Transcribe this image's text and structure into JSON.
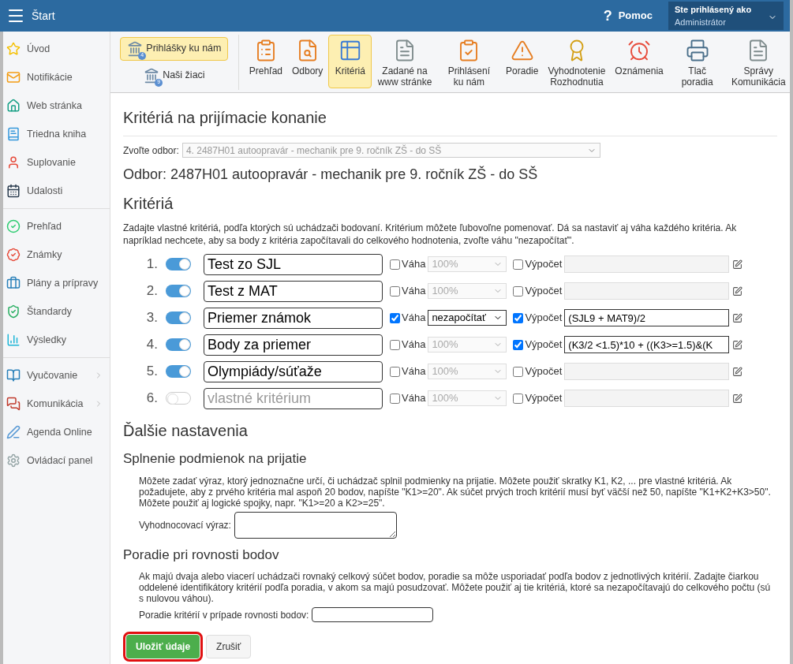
{
  "topbar": {
    "title": "Štart",
    "help": "?",
    "help_label": "Pomoc",
    "user_caption": "Ste prihlásený ako",
    "user_name": "Administrátor"
  },
  "sidebar": {
    "groups": [
      [
        {
          "label": "Úvod"
        },
        {
          "label": "Notifikácie"
        },
        {
          "label": "Web stránka"
        },
        {
          "label": "Triedna kniha"
        },
        {
          "label": "Suplovanie"
        },
        {
          "label": "Udalosti"
        }
      ],
      [
        {
          "label": "Prehľad"
        },
        {
          "label": "Známky"
        },
        {
          "label": "Plány a prípravy"
        },
        {
          "label": "Štandardy"
        },
        {
          "label": "Výsledky"
        }
      ],
      [
        {
          "label": "Vyučovanie",
          "submenu": true
        },
        {
          "label": "Komunikácia",
          "submenu": true
        },
        {
          "label": "Agenda Online",
          "submenu": false
        },
        {
          "label": "Ovládací panel",
          "submenu": false
        }
      ]
    ]
  },
  "toolbar": {
    "left": [
      {
        "label": "Prihlášky ku nám",
        "badge": "4",
        "selected": true
      },
      {
        "label": "Naši žiaci",
        "badge": "9",
        "selected": false
      }
    ],
    "items": [
      {
        "label": "Prehľad",
        "selected": false
      },
      {
        "label": "Odbory",
        "selected": false
      },
      {
        "label": "Kritériá",
        "selected": true
      },
      {
        "label": "Zadané na www stránke",
        "selected": false
      },
      {
        "label": "Prihlásení ku nám",
        "selected": false
      },
      {
        "label": "Poradie",
        "selected": false
      },
      {
        "label": "Vyhodnotenie Rozhodnutia",
        "selected": false
      },
      {
        "label": "Oznámenia",
        "selected": false
      },
      {
        "label": "Tlač poradia",
        "selected": false
      },
      {
        "label": "Správy Komunikácia",
        "selected": false
      }
    ]
  },
  "page": {
    "title": "Kritériá na prijímacie konanie",
    "field_label": "Zvoľte odbor:",
    "field_value": "4. 2487H01 autoopravár - mechanik pre 9. ročník ZŠ - do SŠ",
    "subtitle": "Odbor: 2487H01 autoopravár - mechanik pre 9. ročník ZŠ - do SŠ"
  },
  "criteria": {
    "heading": "Kritériá",
    "description": "Zadajte vlastné kritériá, podľa ktorých sú uchádzači bodovaní. Kritérium môžete ľubovoľne pomenovať. Dá sa nastaviť aj váha každého kritéria. Ak napríklad nechcete, aby sa body z kritéria započítavali do celkového hodnotenia, zvoľte váhu \"nezapočítať\".",
    "rows": [
      {
        "number": "1.",
        "on": true,
        "name": "Test zo SJL",
        "weight_label": "Váha",
        "weight_checked": false,
        "weight": "100%",
        "calc_label": "Výpočet",
        "calc_checked": false
      },
      {
        "number": "2.",
        "on": true,
        "name": "Test z MAT",
        "weight_label": "Váha",
        "weight_checked": false,
        "weight": "100%",
        "calc_label": "Výpočet",
        "calc_checked": false
      },
      {
        "number": "3.",
        "on": true,
        "name": "Priemer známok",
        "weight_label": "Váha",
        "weight_checked": true,
        "weight": "nezapočítať",
        "calc_label": "Výpočet",
        "calc_checked": true,
        "formula": "(SJL9 + MAT9)/2"
      },
      {
        "number": "4.",
        "on": true,
        "name": "Body za priemer",
        "weight_label": "Váha",
        "weight_checked": false,
        "weight": "100%",
        "calc_label": "Výpočet",
        "calc_checked": true,
        "formula": "(K3/2 <1.5)*10 + ((K3>=1.5)&(K"
      },
      {
        "number": "5.",
        "on": true,
        "name": "Olympiády/súťaže",
        "weight_label": "Váha",
        "weight_checked": false,
        "weight": "100%",
        "calc_label": "Výpočet",
        "calc_checked": false
      },
      {
        "number": "6.",
        "on": false,
        "placeholder": "vlastné kritérium",
        "weight_label": "Váha",
        "weight_checked": false,
        "weight": "100%",
        "calc_label": "Výpočet",
        "calc_checked": false
      }
    ]
  },
  "more": {
    "heading": "Ďalšie nastavenia",
    "conditions": {
      "heading": "Splnenie podmienok na prijatie",
      "text": "Môžete zadať výraz, ktorý jednoznačne určí, či uchádzač splnil podmienky na prijatie. Môžete použiť skratky K1, K2, ... pre vlastné kritériá. Ak požadujete, aby z prvého kritéria mal aspoň 20 bodov, napíšte \"K1>=20\". Ak súčet prvých troch kritérií musí byť väčší než 50, napíšte \"K1+K2+K3>50\". Môžete použiť aj logické spojky, napr. \"K1>=20 a K2>=25\".",
      "field_label": "Vyhodnocovací výraz:"
    },
    "ties": {
      "heading": "Poradie pri rovnosti bodov",
      "text": "Ak majú dvaja alebo viacerí uchádzači rovnaký celkový súčet bodov, poradie sa môže usporiadať podľa bodov z jednotlivých kritérií. Zadajte čiarkou oddelené identifikátory kritérií podľa poradia, v akom sa majú posudzovať. Môžete použiť aj tie kritériá, ktoré sa nezapočítavajú do celkového počtu (sú s nulovou váhou).",
      "field_label": "Poradie kritérií v prípade rovnosti bodov:"
    }
  },
  "buttons": [
    {
      "label": "Uložiť údaje",
      "kind": "primary",
      "highlighted": true
    },
    {
      "label": "Zrušiť",
      "kind": "secondary",
      "highlighted": false
    }
  ]
}
